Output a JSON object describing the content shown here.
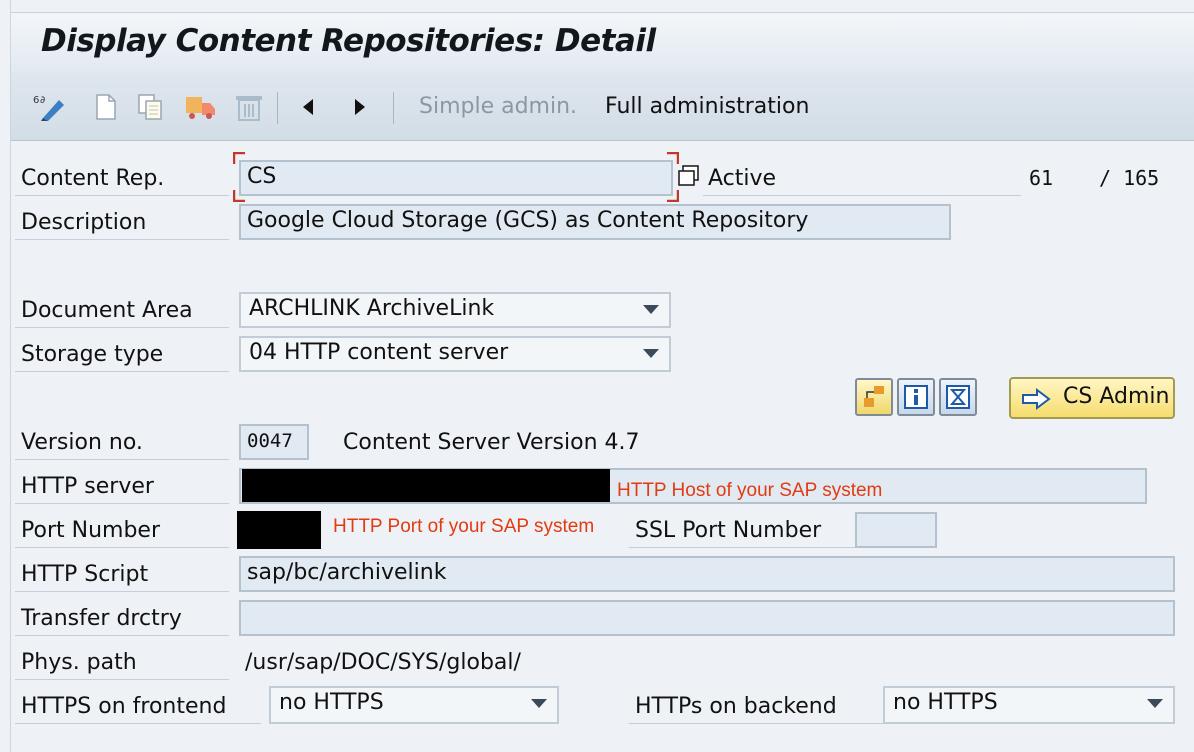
{
  "window": {
    "title": "Display Content Repositories: Detail"
  },
  "toolbar": {
    "icons": [
      "display-change-icon",
      "new-entry-icon",
      "copy-icon",
      "transport-icon",
      "delete-icon",
      "previous-icon",
      "next-icon"
    ],
    "simple_admin": "Simple admin.",
    "full_admin": "Full administration"
  },
  "form": {
    "content_rep": {
      "label": "Content Rep.",
      "value": "CS",
      "status": "Active",
      "position": "61",
      "total": "/ 165"
    },
    "description": {
      "label": "Description",
      "value": "Google Cloud Storage (GCS) as Content Repository"
    },
    "document_area": {
      "label": "Document Area",
      "value": "ARCHLINK ArchiveLink"
    },
    "storage_type": {
      "label": "Storage type",
      "value": "04 HTTP content server"
    },
    "cs_admin_button": "CS Admin",
    "version": {
      "label": "Version no.",
      "value": "0047",
      "text": "Content Server Version 4.7"
    },
    "http_server": {
      "label": "HTTP server",
      "annotation": "HTTP Host of your SAP system"
    },
    "port_number": {
      "label": "Port Number",
      "annotation": "HTTP Port of your SAP system"
    },
    "ssl_port": {
      "label": "SSL Port Number",
      "value": ""
    },
    "http_script": {
      "label": "HTTP Script",
      "value": "sap/bc/archivelink"
    },
    "transfer_dir": {
      "label": "Transfer drctry",
      "value": ""
    },
    "phys_path": {
      "label": "Phys. path",
      "value": "/usr/sap/DOC/SYS/global/"
    },
    "https_frontend": {
      "label": "HTTPS on frontend",
      "value": "no HTTPS"
    },
    "https_backend": {
      "label": "HTTPs on backend",
      "value": "no HTTPS"
    }
  },
  "colors": {
    "annotation": "#e23b12",
    "field_bg": "#e1eaf2",
    "accent_button": "#f7e27a"
  }
}
